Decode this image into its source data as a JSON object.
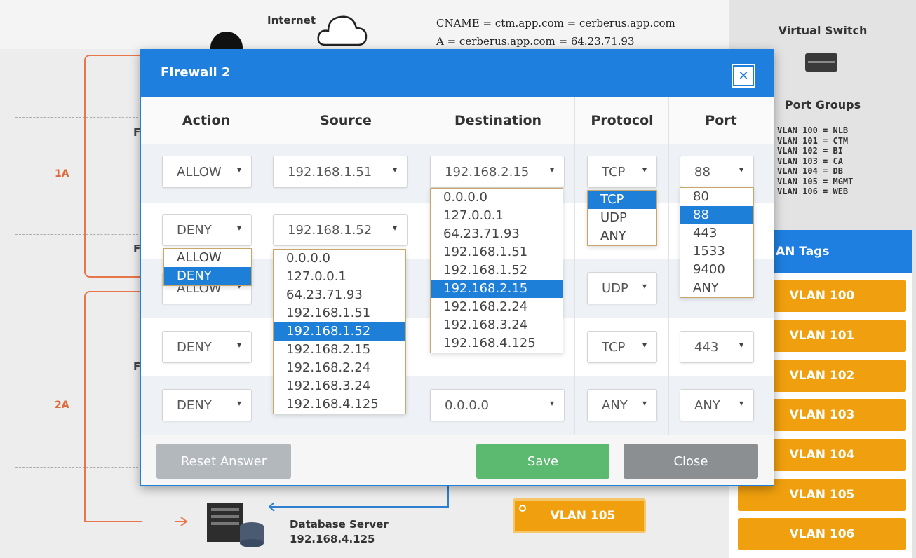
{
  "diagram": {
    "internet_label": "Internet",
    "dns_records": [
      "CNAME = ctm.app.com = cerberus.app.com",
      "A = cerberus.app.com = 64.23.71.93"
    ],
    "segments": [
      "1A",
      "2A"
    ],
    "db_server_title": "Database Server",
    "db_server_ip": "192.168.4.125",
    "floating_vlan": "VLAN 105"
  },
  "right_panel": {
    "virtual_switch_title": "Virtual Switch",
    "port_groups_title": "Port Groups",
    "port_groups": [
      "VLAN 100 = NLB",
      "VLAN 101 = CTM",
      "VLAN 102 = BI",
      "VLAN 103 = CA",
      "VLAN 104 = DB",
      "VLAN 105 = MGMT",
      "VLAN 106 = WEB"
    ],
    "vlan_tags_title": "AN Tags",
    "vlan_tags": [
      "VLAN 100",
      "VLAN 101",
      "VLAN 102",
      "VLAN 103",
      "VLAN 104",
      "VLAN 105",
      "VLAN 106"
    ]
  },
  "modal": {
    "title": "Firewall 2",
    "close_icon": "close-icon",
    "columns": [
      "Action",
      "Source",
      "Destination",
      "Protocol",
      "Port"
    ],
    "rules": [
      {
        "action": "ALLOW",
        "source": "192.168.1.51",
        "destination": "192.168.2.15",
        "protocol": "TCP",
        "port": "88"
      },
      {
        "action": "DENY",
        "source": "192.168.1.52",
        "destination": "",
        "protocol": "",
        "port": ""
      },
      {
        "action": "ALLOW",
        "source": "",
        "destination": "",
        "protocol": "UDP",
        "port": ""
      },
      {
        "action": "DENY",
        "source": "",
        "destination": "",
        "protocol": "TCP",
        "port": "443"
      },
      {
        "action": "DENY",
        "source": "",
        "destination": "0.0.0.0",
        "protocol": "ANY",
        "port": "ANY"
      }
    ],
    "open_dropdowns": {
      "action": {
        "options": [
          "ALLOW",
          "DENY"
        ],
        "selected": "DENY"
      },
      "source": {
        "options": [
          "0.0.0.0",
          "127.0.0.1",
          "64.23.71.93",
          "192.168.1.51",
          "192.168.1.52",
          "192.168.2.15",
          "192.168.2.24",
          "192.168.3.24",
          "192.168.4.125"
        ],
        "selected": "192.168.1.52"
      },
      "destination": {
        "options": [
          "0.0.0.0",
          "127.0.0.1",
          "64.23.71.93",
          "192.168.1.51",
          "192.168.1.52",
          "192.168.2.15",
          "192.168.2.24",
          "192.168.3.24",
          "192.168.4.125"
        ],
        "selected": "192.168.2.15"
      },
      "protocol": {
        "options": [
          "TCP",
          "UDP",
          "ANY"
        ],
        "selected": "TCP"
      },
      "port": {
        "options": [
          "80",
          "88",
          "443",
          "1533",
          "9400",
          "ANY"
        ],
        "selected": "88"
      }
    },
    "buttons": {
      "reset": "Reset Answer",
      "save": "Save",
      "close": "Close"
    },
    "colors": {
      "header": "#1f7fde",
      "selected_option": "#1e7fd8",
      "save": "#5cb970",
      "close": "#8b8f92",
      "reset": "#b3b8bd",
      "vlan_tag": "#f0a00e"
    }
  }
}
